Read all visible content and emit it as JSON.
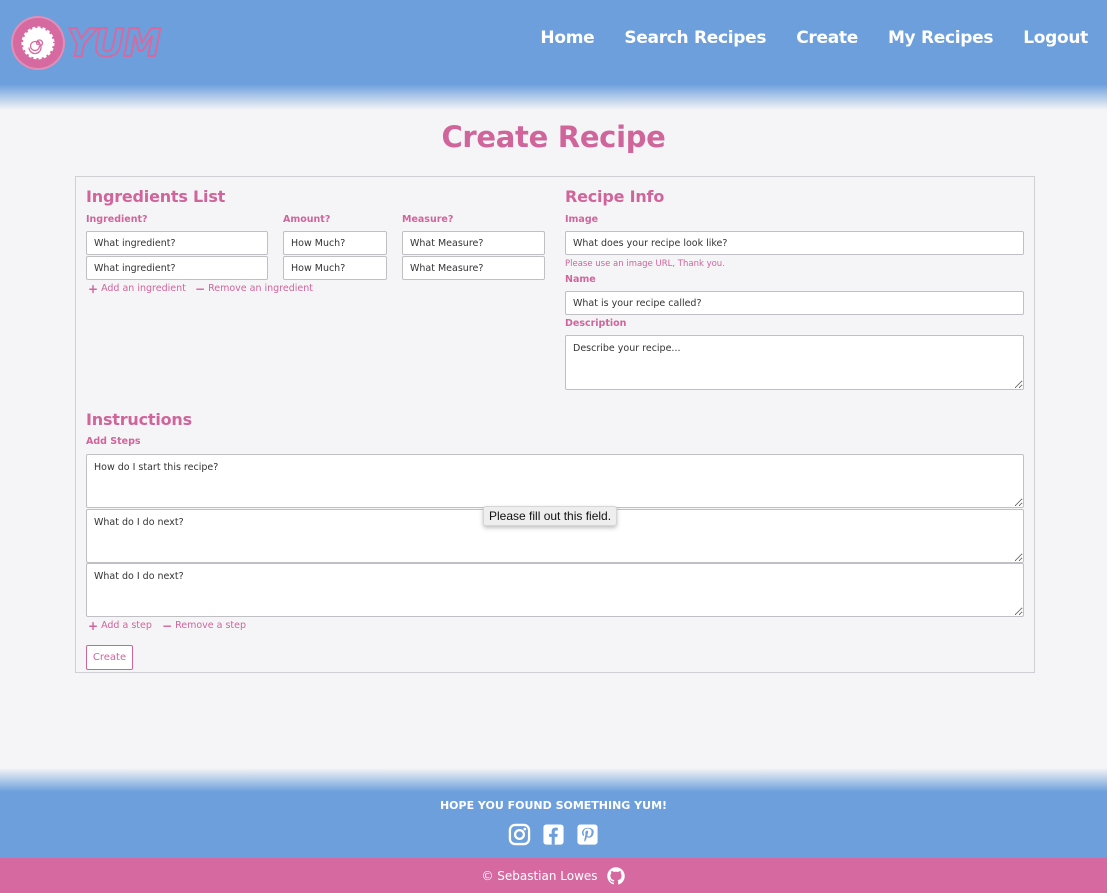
{
  "brand": {
    "name": "YUM"
  },
  "nav": [
    {
      "label": "Home"
    },
    {
      "label": "Search Recipes"
    },
    {
      "label": "Create"
    },
    {
      "label": "My Recipes"
    },
    {
      "label": "Logout"
    }
  ],
  "page_title": "Create Recipe",
  "ingredients": {
    "title": "Ingredients List",
    "col_ingredient": "Ingredient?",
    "col_amount": "Amount?",
    "col_measure": "Measure?",
    "rows": [
      {
        "ingredient_placeholder": "What ingredient?",
        "amount_placeholder": "How Much?",
        "measure_placeholder": "What Measure?"
      },
      {
        "ingredient_placeholder": "What ingredient?",
        "amount_placeholder": "How Much?",
        "measure_placeholder": "What Measure?"
      }
    ],
    "add_label": "Add an ingredient",
    "remove_label": "Remove an ingredient"
  },
  "recipe_info": {
    "title": "Recipe Info",
    "image_label": "Image",
    "image_placeholder": "What does your recipe look like?",
    "image_helper": "Please use an image URL, Thank you.",
    "name_label": "Name",
    "name_placeholder": "What is your recipe called?",
    "description_label": "Description",
    "description_placeholder": "Describe your recipe..."
  },
  "instructions": {
    "title": "Instructions",
    "steps_label": "Add Steps",
    "steps": [
      {
        "placeholder": "How do I start this recipe?"
      },
      {
        "placeholder": "What do I do next?"
      },
      {
        "placeholder": "What do I do next?"
      }
    ],
    "add_label": "Add a step",
    "remove_label": "Remove a step"
  },
  "submit_label": "Create",
  "validation_tooltip": "Please fill out this field.",
  "footer": {
    "tagline": "HOPE YOU FOUND SOMETHING YUM!",
    "socials": [
      "instagram-icon",
      "facebook-icon",
      "pinterest-icon"
    ],
    "copyright": "© Sebastian Lowes"
  },
  "colors": {
    "primary_blue": "#6c9fdc",
    "accent_pink": "#d0659b",
    "footer_pink": "#d66aa0",
    "background": "#f5f5f7"
  }
}
